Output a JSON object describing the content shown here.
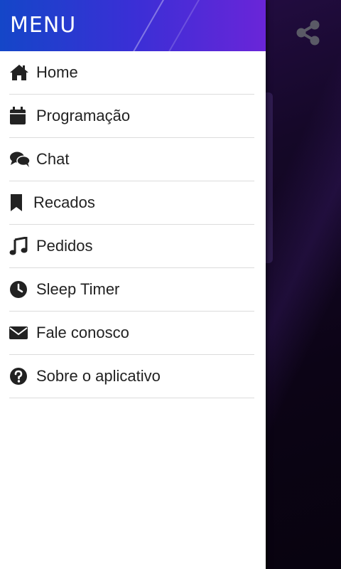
{
  "drawer": {
    "title": "MENU",
    "items": [
      {
        "label": "Home",
        "icon": "home-icon"
      },
      {
        "label": "Programação",
        "icon": "calendar-icon"
      },
      {
        "label": "Chat",
        "icon": "chat-icon"
      },
      {
        "label": "Recados",
        "icon": "bookmark-icon"
      },
      {
        "label": "Pedidos",
        "icon": "music-icon"
      },
      {
        "label": "Sleep Timer",
        "icon": "clock-icon"
      },
      {
        "label": "Fale conosco",
        "icon": "envelope-icon"
      },
      {
        "label": "Sobre o aplicativo",
        "icon": "question-icon"
      }
    ]
  },
  "app": {
    "share_icon": "share-icon"
  },
  "colors": {
    "header_start": "#1446c8",
    "header_end": "#6a25d8",
    "text": "#222222",
    "background": "#0d0518"
  }
}
